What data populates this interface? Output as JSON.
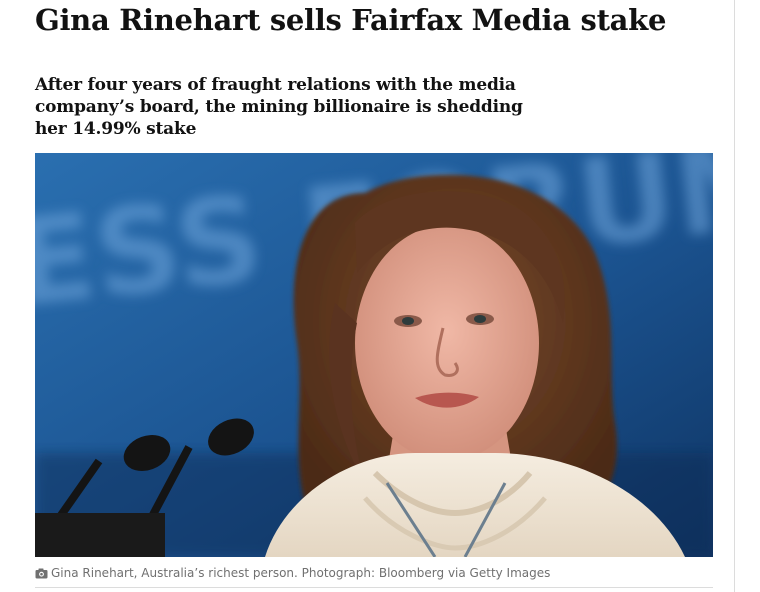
{
  "article": {
    "headline": "Gina Rinehart sells Fairfax Media stake",
    "standfirst": "After four years of fraught relations with the media company’s board, the mining billionaire is shedding her 14.99% stake",
    "image": {
      "background_color": "#1d5c9a",
      "background_text": "ESS FORUM"
    },
    "caption": {
      "icon": "camera-icon",
      "text": "Gina Rinehart, Australia’s richest person. Photograph: Bloomberg via Getty Images"
    }
  }
}
